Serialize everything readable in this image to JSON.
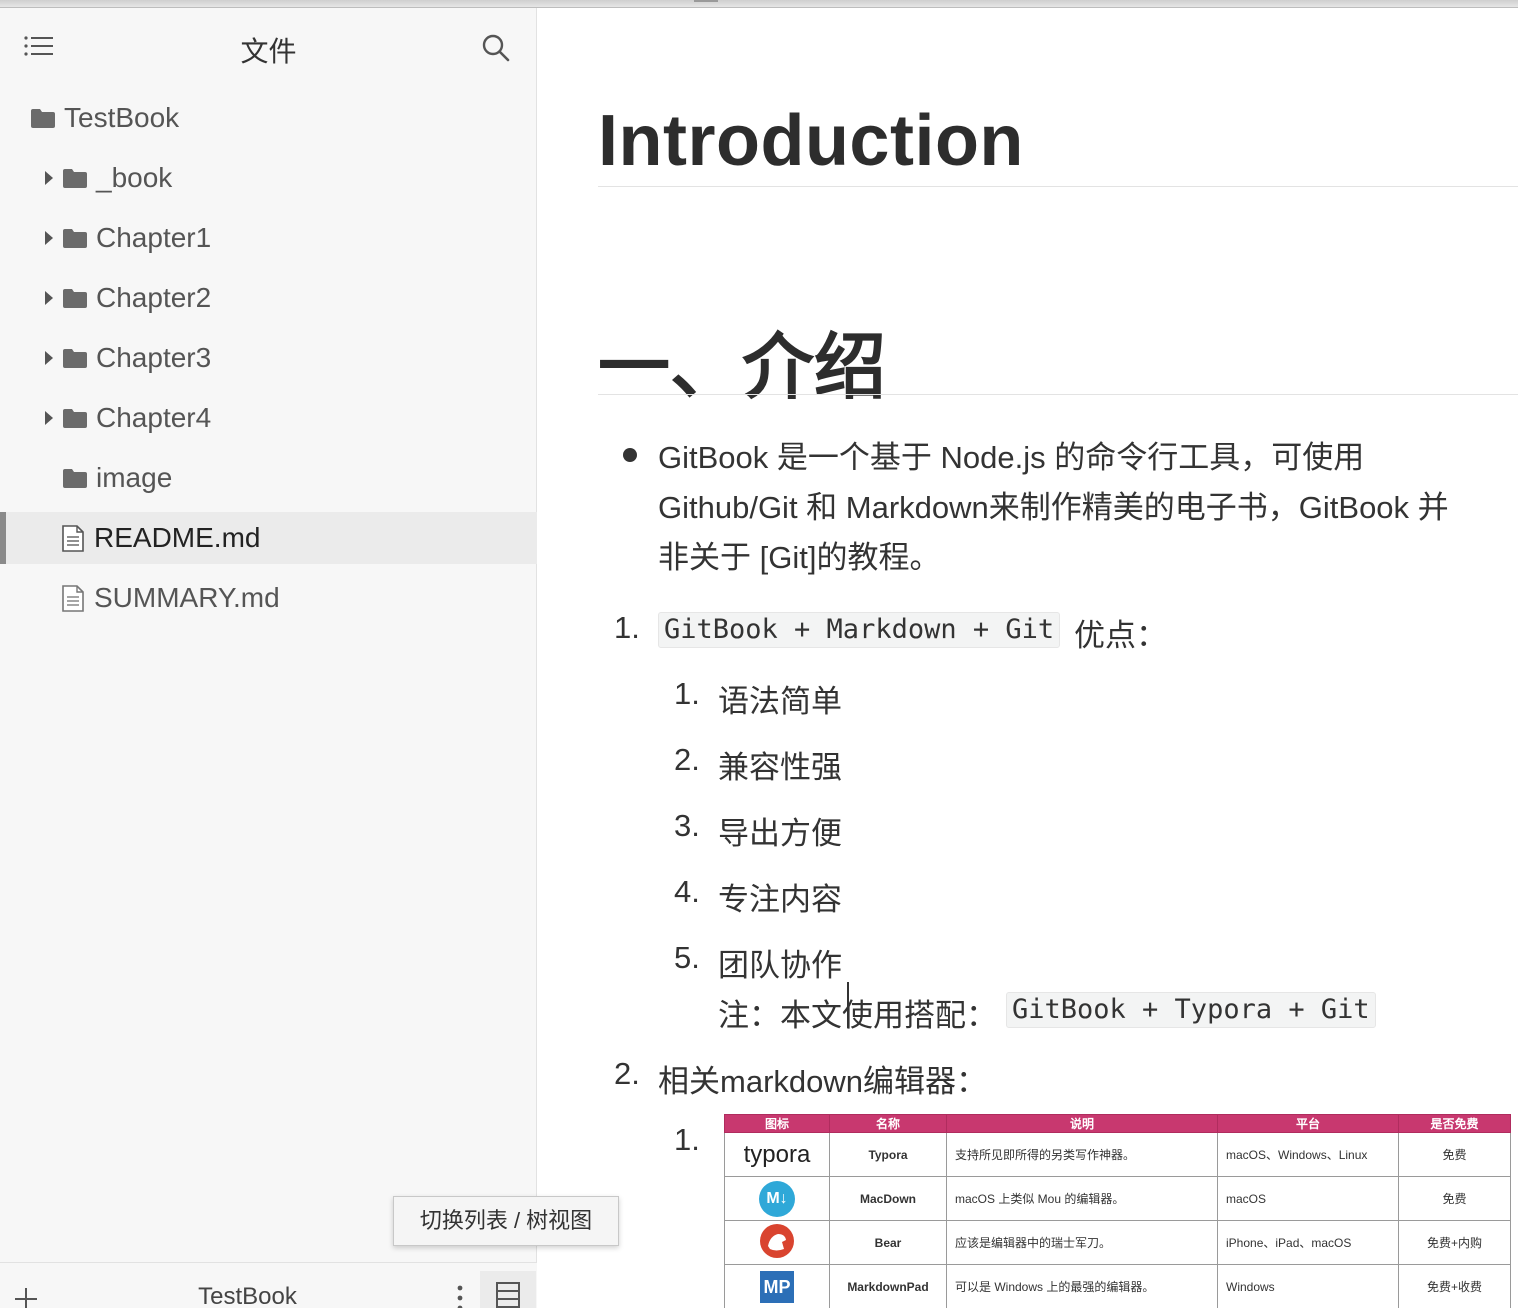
{
  "sidebar": {
    "title": "文件",
    "tree": [
      {
        "label": "TestBook",
        "kind": "root-folder"
      },
      {
        "label": "_book",
        "kind": "folder"
      },
      {
        "label": "Chapter1",
        "kind": "folder"
      },
      {
        "label": "Chapter2",
        "kind": "folder"
      },
      {
        "label": "Chapter3",
        "kind": "folder"
      },
      {
        "label": "Chapter4",
        "kind": "folder"
      },
      {
        "label": "image",
        "kind": "folder-leaf"
      },
      {
        "label": "README.md",
        "kind": "file",
        "active": true
      },
      {
        "label": "SUMMARY.md",
        "kind": "file"
      }
    ],
    "tooltip": "切换列表 / 树视图",
    "footer_title": "TestBook"
  },
  "document": {
    "h1": "Introduction",
    "h2": "一、介绍",
    "bullet_lines": [
      "GitBook 是一个基于 Node.js 的命令行工具，可使用",
      "Github/Git 和 Markdown来制作精美的电子书，GitBook 并",
      "非关于 [Git]的教程。"
    ],
    "list1": {
      "number": "1.",
      "code": "GitBook + Markdown + Git",
      "suffix": "优点："
    },
    "advantages": [
      {
        "number": "1.",
        "text": "语法简单"
      },
      {
        "number": "2.",
        "text": "兼容性强"
      },
      {
        "number": "3.",
        "text": "导出方便"
      },
      {
        "number": "4.",
        "text": "专注内容"
      },
      {
        "number": "5.",
        "text": "团队协作"
      }
    ],
    "note": {
      "prefix": "注：本文使用搭配：",
      "code": "GitBook + Typora + Git"
    },
    "list2": {
      "number": "2.",
      "text": "相关markdown编辑器："
    },
    "sub_number": "1.",
    "editors_table": {
      "headers": [
        "图标",
        "名称",
        "说明",
        "平台",
        "是否免费"
      ],
      "rows": [
        {
          "icon": "typora",
          "name": "Typora",
          "desc": "支持所见即所得的另类写作神器。",
          "platform": "macOS、Windows、Linux",
          "price": "免费"
        },
        {
          "icon": "M↓",
          "name": "MacDown",
          "desc": "macOS 上类似 Mou 的编辑器。",
          "platform": "macOS",
          "price": "免费"
        },
        {
          "icon": "bear-icon",
          "name": "Bear",
          "desc": "应该是编辑器中的瑞士军刀。",
          "platform": "iPhone、iPad、macOS",
          "price": "免费+内购"
        },
        {
          "icon": "MP",
          "name": "MarkdownPad",
          "desc": "可以是 Windows 上的最强的编辑器。",
          "platform": "Windows",
          "price": "免费+收费"
        }
      ]
    }
  },
  "colors": {
    "sidebar_bg": "#f7f7f7",
    "active_row_bg": "#ebebeb",
    "table_header": "#c8386f"
  }
}
